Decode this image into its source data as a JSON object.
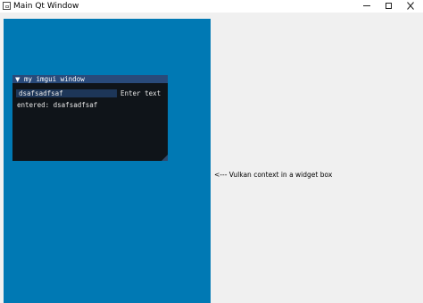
{
  "window": {
    "title": "Main Qt Window",
    "icons": {
      "app": "window-icon",
      "minimize": "minimize-icon",
      "maximize": "maximize-icon",
      "close": "close-icon"
    }
  },
  "vulkan_area": {
    "color": "#0079b4",
    "imgui_window": {
      "title": "my imgui window",
      "collapse_icon": "collapse-triangle-icon",
      "input_value": "dsafsadfsaf",
      "input_label": "Enter text",
      "entered_text": "entered: dsafsadfsaf",
      "colors": {
        "title_bar": "#294a7a",
        "body": "#0f1419",
        "input_bg": "#1d3658"
      }
    }
  },
  "side_label": "<--- Vulkan context in a widget box"
}
